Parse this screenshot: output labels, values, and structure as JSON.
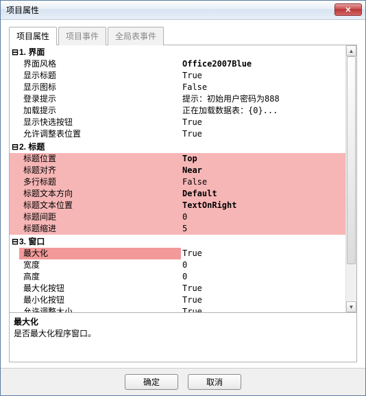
{
  "window": {
    "title": "项目属性",
    "close_label": "✕"
  },
  "tabs": {
    "t0": "项目属性",
    "t1": "项目事件",
    "t2": "全局表事件"
  },
  "sections": {
    "s1": {
      "num": "1.",
      "name": "界面",
      "twist": "⊟"
    },
    "s2": {
      "num": "2.",
      "name": "标题",
      "twist": "⊟"
    },
    "s3": {
      "num": "3.",
      "name": "窗口",
      "twist": "⊟"
    }
  },
  "props": {
    "interface_style": {
      "k": "界面风格",
      "v": "Office2007Blue"
    },
    "show_title": {
      "k": "显示标题",
      "v": "True"
    },
    "show_icon": {
      "k": "显示图标",
      "v": "False"
    },
    "login_tip": {
      "k": "登录提示",
      "v": "提示：初始用户密码为888"
    },
    "loading_tip": {
      "k": "加载提示",
      "v": "正在加载数据表：{0}..."
    },
    "show_quick_btn": {
      "k": "显示快选按钮",
      "v": "True"
    },
    "allow_resize_table": {
      "k": "允许调整表位置",
      "v": "True"
    },
    "title_position": {
      "k": "标题位置",
      "v": "Top"
    },
    "title_align": {
      "k": "标题对齐",
      "v": "Near"
    },
    "multi_line_title": {
      "k": "多行标题",
      "v": "False"
    },
    "title_text_dir": {
      "k": "标题文本方向",
      "v": "Default"
    },
    "title_text_pos": {
      "k": "标题文本位置",
      "v": "TextOnRight"
    },
    "title_spacing": {
      "k": "标题间距",
      "v": "0"
    },
    "title_indent": {
      "k": "标题缩进",
      "v": "5"
    },
    "maximize": {
      "k": "最大化",
      "v": "True"
    },
    "width": {
      "k": "宽度",
      "v": "0"
    },
    "height": {
      "k": "高度",
      "v": "0"
    },
    "max_button": {
      "k": "最大化按钮",
      "v": "True"
    },
    "min_button": {
      "k": "最小化按钮",
      "v": "True"
    },
    "allow_resize": {
      "k": "允许调整大小",
      "v": "True"
    }
  },
  "description": {
    "title": "最大化",
    "text": "是否最大化程序窗口。"
  },
  "buttons": {
    "ok": "确定",
    "cancel": "取消"
  }
}
